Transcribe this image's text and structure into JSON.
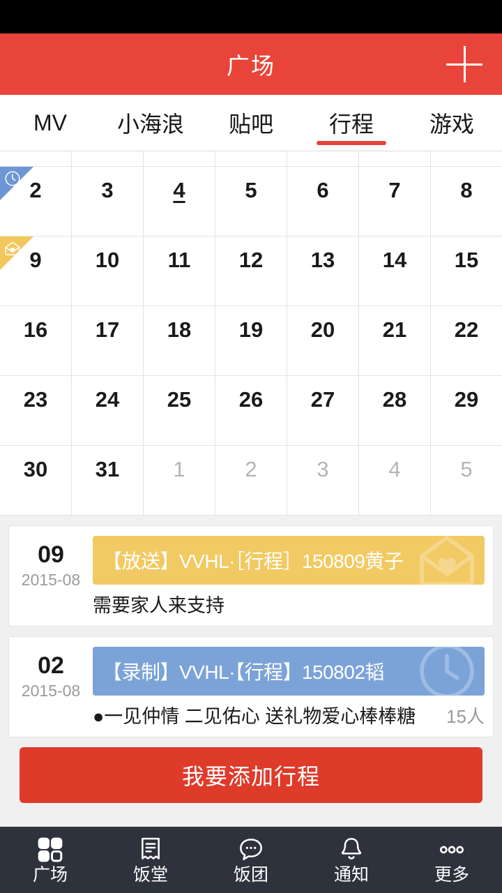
{
  "header": {
    "title": "广场",
    "add_icon": "plus-icon"
  },
  "tabs": [
    {
      "label": "MV",
      "active": false
    },
    {
      "label": "小海浪",
      "active": false
    },
    {
      "label": "贴吧",
      "active": false
    },
    {
      "label": "行程",
      "active": true
    },
    {
      "label": "游戏",
      "active": false
    }
  ],
  "calendar": {
    "rows": [
      {
        "partial": true,
        "cells": [
          {
            "num": ""
          },
          {
            "num": ""
          },
          {
            "num": ""
          },
          {
            "num": ""
          },
          {
            "num": ""
          },
          {
            "num": ""
          },
          {
            "num": ""
          }
        ]
      },
      {
        "partial": false,
        "cells": [
          {
            "num": "2",
            "muted": false,
            "today": false,
            "flag": "blue",
            "flag_icon": "clock-icon"
          },
          {
            "num": "3",
            "muted": false,
            "today": false
          },
          {
            "num": "4",
            "muted": false,
            "today": true
          },
          {
            "num": "5",
            "muted": false,
            "today": false
          },
          {
            "num": "6",
            "muted": false,
            "today": false
          },
          {
            "num": "7",
            "muted": false,
            "today": false
          },
          {
            "num": "8",
            "muted": false,
            "today": false
          }
        ]
      },
      {
        "partial": false,
        "cells": [
          {
            "num": "9",
            "muted": false,
            "today": false,
            "flag": "yellow",
            "flag_icon": "envelope-heart-icon"
          },
          {
            "num": "10",
            "muted": false,
            "today": false
          },
          {
            "num": "11",
            "muted": false,
            "today": false
          },
          {
            "num": "12",
            "muted": false,
            "today": false
          },
          {
            "num": "13",
            "muted": false,
            "today": false
          },
          {
            "num": "14",
            "muted": false,
            "today": false
          },
          {
            "num": "15",
            "muted": false,
            "today": false
          }
        ]
      },
      {
        "partial": false,
        "cells": [
          {
            "num": "16"
          },
          {
            "num": "17"
          },
          {
            "num": "18"
          },
          {
            "num": "19"
          },
          {
            "num": "20"
          },
          {
            "num": "21"
          },
          {
            "num": "22"
          }
        ]
      },
      {
        "partial": false,
        "cells": [
          {
            "num": "23"
          },
          {
            "num": "24"
          },
          {
            "num": "25"
          },
          {
            "num": "26"
          },
          {
            "num": "27"
          },
          {
            "num": "28"
          },
          {
            "num": "29"
          }
        ]
      },
      {
        "partial": false,
        "cells": [
          {
            "num": "30",
            "muted": false
          },
          {
            "num": "31",
            "muted": false
          },
          {
            "num": "1",
            "muted": true
          },
          {
            "num": "2",
            "muted": true
          },
          {
            "num": "3",
            "muted": true
          },
          {
            "num": "4",
            "muted": true
          },
          {
            "num": "5",
            "muted": true
          }
        ]
      }
    ]
  },
  "events": [
    {
      "day": "09",
      "month": "2015-08",
      "title": "【放送】VVHL·［行程］150809黄子",
      "desc": "需要家人来支持",
      "count": "",
      "color": "yellow",
      "watermark_icon": "envelope-heart-icon"
    },
    {
      "day": "02",
      "month": "2015-08",
      "title": "【录制】VVHL·【行程】150802韬",
      "desc": "●一见仲情 二见佑心 送礼物爱心棒棒糖",
      "count": "15人",
      "color": "blue",
      "watermark_icon": "clock-icon"
    }
  ],
  "add_button": {
    "label": "我要添加行程"
  },
  "bottom_nav": [
    {
      "label": "广场",
      "icon": "grid-icon",
      "active": true
    },
    {
      "label": "饭堂",
      "icon": "receipt-icon",
      "active": false
    },
    {
      "label": "饭团",
      "icon": "chat-bubble-icon",
      "active": false
    },
    {
      "label": "通知",
      "icon": "bell-icon",
      "active": false
    },
    {
      "label": "更多",
      "icon": "more-dots-icon",
      "active": false
    }
  ],
  "colors": {
    "brand_red": "#e8443a",
    "button_red": "#de3b2b",
    "nav_dark": "#2e323c",
    "flag_blue": "#6d96d4",
    "flag_yellow": "#f2c75c",
    "banner_yellow": "#f2ca63",
    "banner_blue": "#7ba3d8"
  }
}
